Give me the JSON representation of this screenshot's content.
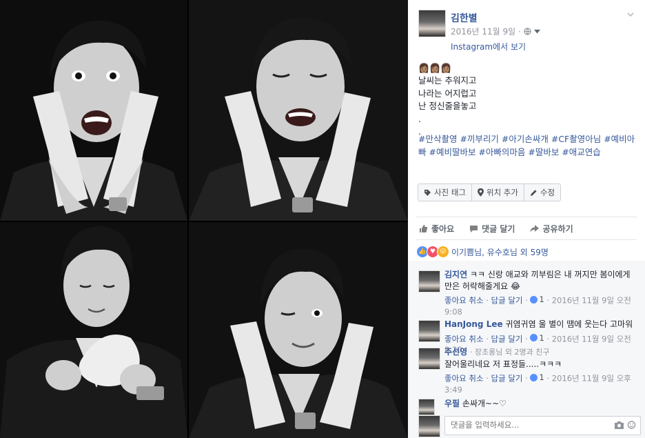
{
  "photos": {
    "tiles": [
      {
        "label": "photo-1",
        "expression": "surprised"
      },
      {
        "label": "photo-2",
        "expression": "eyes-closed"
      },
      {
        "label": "photo-3",
        "expression": "looking-down"
      },
      {
        "label": "photo-4",
        "expression": "wink"
      }
    ]
  },
  "post": {
    "author": "김한별",
    "date": "2016년 11월 9일",
    "date_sep": "·",
    "instagram_link": "Instagram에서 보기",
    "emojis": "👩🏽👩🏽👩🏽",
    "lines": [
      "날씨는 추워지고",
      "나라는 어지럽고",
      "난 정신줄을놓고",
      ".",
      "."
    ],
    "hashtags": "#만삭촬영 #끼부리기 #아기손싸개 #CF촬영아님 #예비아빠 #예비딸바보 #아빠의마음 #딸바보 #애교연습"
  },
  "photo_actions": {
    "tag": "사진 태그",
    "location": "위치 추가",
    "edit": "수정"
  },
  "actions": {
    "like": "좋아요",
    "comment": "댓글 달기",
    "share": "공유하기"
  },
  "reactions": {
    "summary": "이기쁨님, 유수호님 외 59명"
  },
  "comments": [
    {
      "author": "김지연",
      "text": "ㅋㅋ 신랑 애교와 끼부림은 내 꺼지만 봄이에게만은 허락해줄게요 😂",
      "like": "좋아요 취소",
      "reply": "답글 달기",
      "likes": "1",
      "time": "2016년 11월 9일 오전 9:08"
    },
    {
      "author": "HanJong Lee",
      "text": "귀염귀염 울 별이 땜에 웃는다 고마워",
      "like": "좋아요 취소",
      "reply": "답글 달기",
      "likes": "1",
      "time": "2016년 11월 9일 오전 9:20"
    },
    {
      "author": "주선영",
      "author_note": "· 장초롱님 외 2명과 친구",
      "text": "잘어울리네요 저 표정들.....ㅋㅋㅋ",
      "like": "좋아요 취소",
      "reply": "답글 달기",
      "likes": "1",
      "time": "2016년 11월 9일 오후 3:49"
    },
    {
      "author": "우필",
      "text": "손싸개~~♡"
    }
  ],
  "reply_box": {
    "placeholder": "댓글을 입력하세요..."
  },
  "colors": {
    "link": "#365899",
    "meta": "#90949c",
    "like_blue": "#5890ff",
    "love_red": "#f25268",
    "wow_yellow": "#f7b125"
  }
}
